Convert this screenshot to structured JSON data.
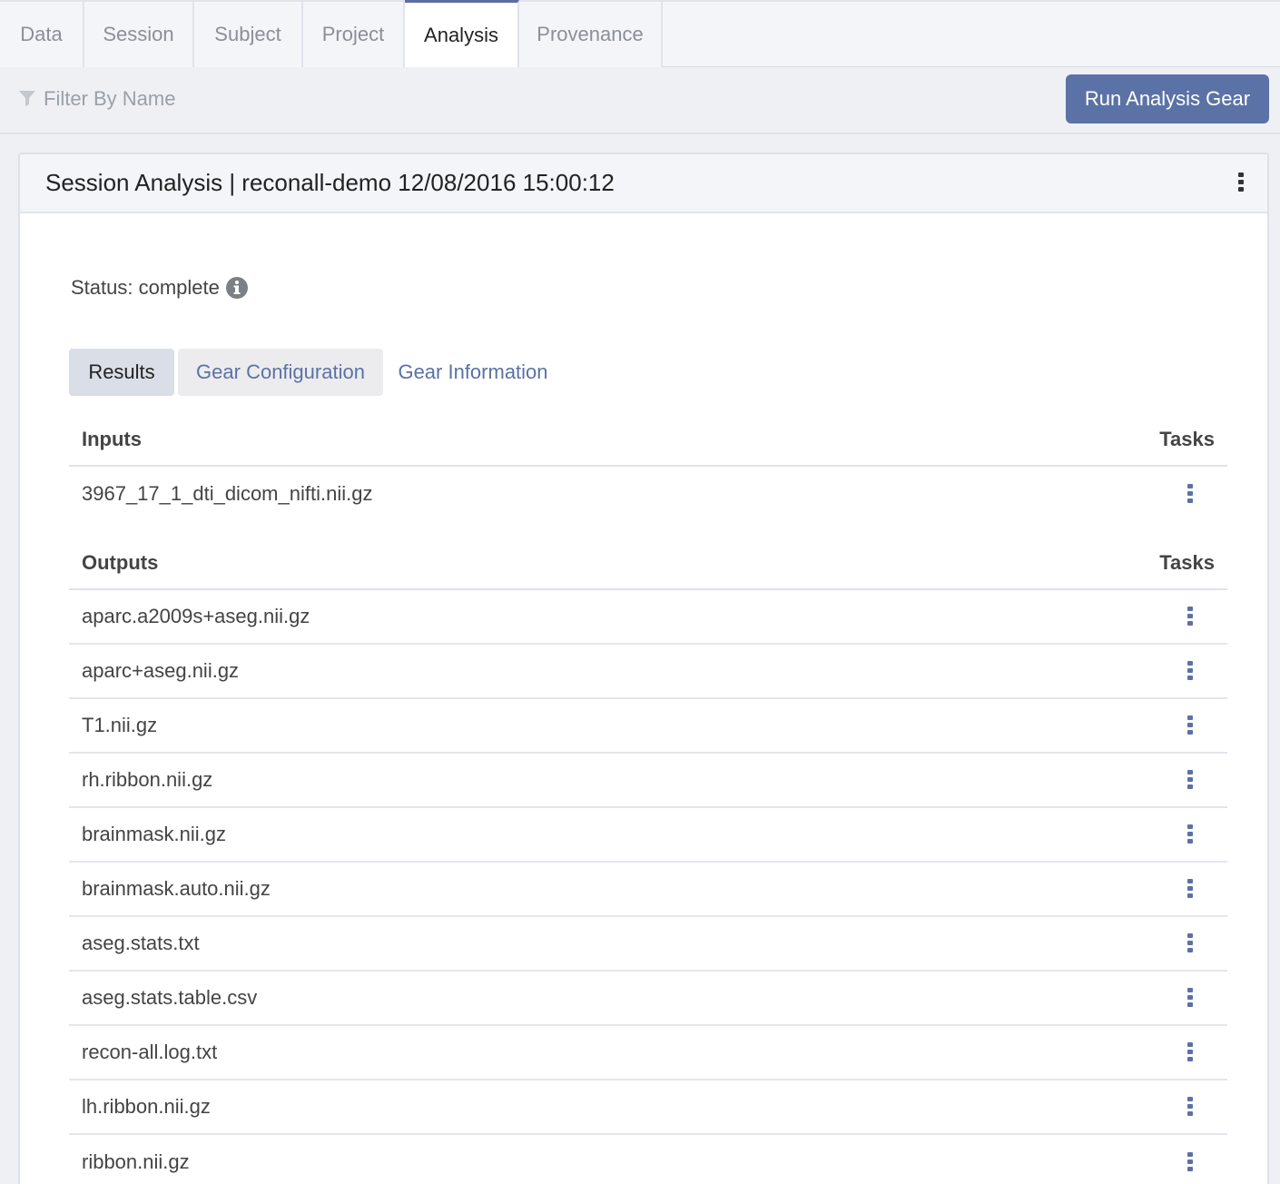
{
  "tabs": [
    {
      "label": "Data"
    },
    {
      "label": "Session"
    },
    {
      "label": "Subject"
    },
    {
      "label": "Project"
    },
    {
      "label": "Analysis",
      "active": true
    },
    {
      "label": "Provenance"
    }
  ],
  "filter": {
    "placeholder": "Filter By Name",
    "value": ""
  },
  "toolbar": {
    "run_label": "Run Analysis Gear"
  },
  "card": {
    "title": "Session Analysis | reconall-demo 12/08/2016 15:00:12",
    "status": "Status: complete"
  },
  "subtabs": [
    {
      "label": "Results"
    },
    {
      "label": "Gear Configuration"
    },
    {
      "label": "Gear Information"
    }
  ],
  "inputs": {
    "header": "Inputs",
    "tasks_header": "Tasks",
    "files": [
      "3967_17_1_dti_dicom_nifti.nii.gz"
    ]
  },
  "outputs": {
    "header": "Outputs",
    "tasks_header": "Tasks",
    "files": [
      "aparc.a2009s+aseg.nii.gz",
      "aparc+aseg.nii.gz",
      "T1.nii.gz",
      "rh.ribbon.nii.gz",
      "brainmask.nii.gz",
      "brainmask.auto.nii.gz",
      "aseg.stats.txt",
      "aseg.stats.table.csv",
      "recon-all.log.txt",
      "lh.ribbon.nii.gz",
      "ribbon.nii.gz"
    ]
  },
  "colors": {
    "accent": "#5b72a6",
    "active_tab_border": "#5a6fa0"
  },
  "icons": {
    "filter": "filter-icon",
    "info": "info-icon",
    "menu": "vertical-dots-icon"
  }
}
